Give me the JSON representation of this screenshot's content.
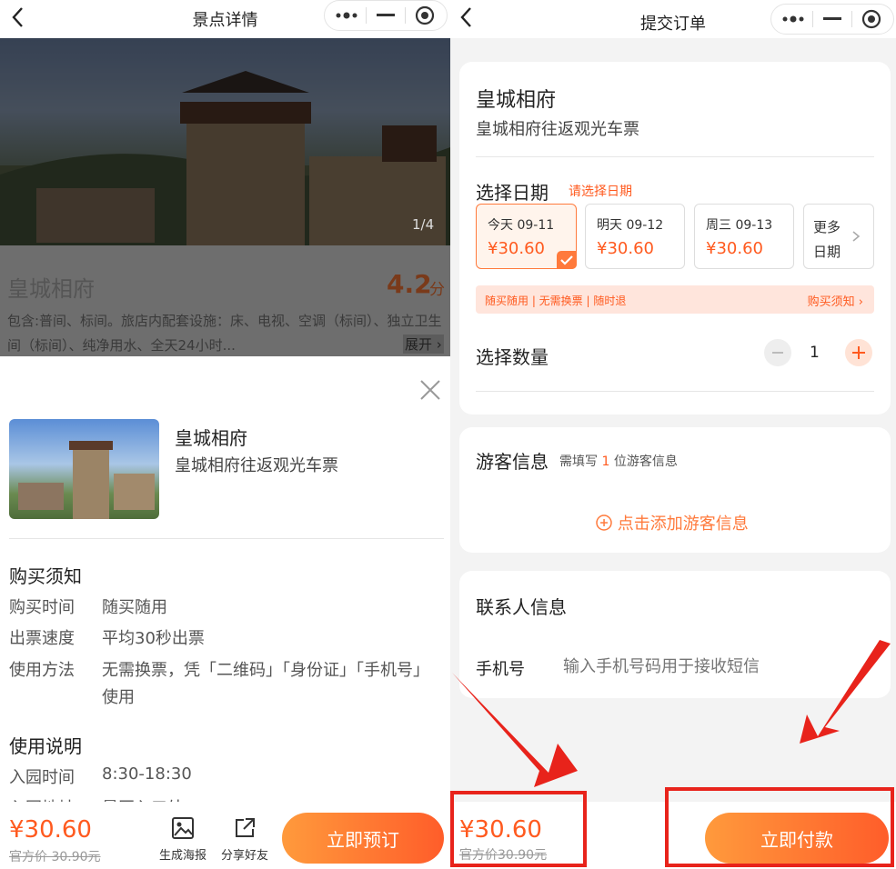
{
  "left": {
    "header": {
      "title": "景点详情"
    },
    "banner": {
      "counter": "1/4"
    },
    "spot": {
      "name": "皇城相府",
      "rating": "4.2",
      "rating_unit": "分",
      "desc": "包含:普间、标间。旅店内配套设施：床、电视、空调（标间）、独立卫生间（标间）、纯净用水、全天24小时...",
      "expand": "展开"
    },
    "product": {
      "title": "皇城相府",
      "subtitle": "皇城相府往返观光车票"
    },
    "notice": {
      "heading": "购买须知",
      "rows": [
        {
          "label": "购买时间",
          "value": "随买随用"
        },
        {
          "label": "出票速度",
          "value": "平均30秒出票"
        },
        {
          "label": "使用方法",
          "value": "无需换票，凭「二维码」「身份证」「手机号」使用"
        }
      ]
    },
    "usage": {
      "heading": "使用说明",
      "rows": [
        {
          "label": "入园时间",
          "value": "8:30-18:30"
        },
        {
          "label": "入园地址",
          "value": "景区入口处"
        }
      ]
    },
    "bottom": {
      "price": "¥30.60",
      "official": "官方价 30.90元",
      "poster": "生成海报",
      "share": "分享好友",
      "book": "立即预订"
    }
  },
  "right": {
    "header": {
      "title": "提交订单"
    },
    "product": {
      "title": "皇城相府",
      "subtitle": "皇城相府往返观光车票"
    },
    "date": {
      "label": "选择日期",
      "hint": "请选择日期",
      "options": [
        {
          "day": "今天 09-11",
          "price": "¥30.60"
        },
        {
          "day": "明天 09-12",
          "price": "¥30.60"
        },
        {
          "day": "周三 09-13",
          "price": "¥30.60"
        }
      ],
      "more": "更多日期"
    },
    "tags": {
      "text": "随买随用 | 无需换票 | 随时退",
      "link": "购买须知"
    },
    "quantity": {
      "label": "选择数量",
      "value": "1"
    },
    "visitor": {
      "title": "游客信息",
      "hint_pre": "需填写",
      "hint_num": "1",
      "hint_post": "位游客信息",
      "add": "点击添加游客信息"
    },
    "contact": {
      "title": "联系人信息",
      "phone_label": "手机号",
      "phone_placeholder": "输入手机号码用于接收短信"
    },
    "bottom": {
      "price": "¥30.60",
      "official": "官方价30.90元",
      "pay": "立即付款"
    }
  },
  "colors": {
    "accent": "#ff5a1f",
    "annotation": "#e8231b"
  }
}
